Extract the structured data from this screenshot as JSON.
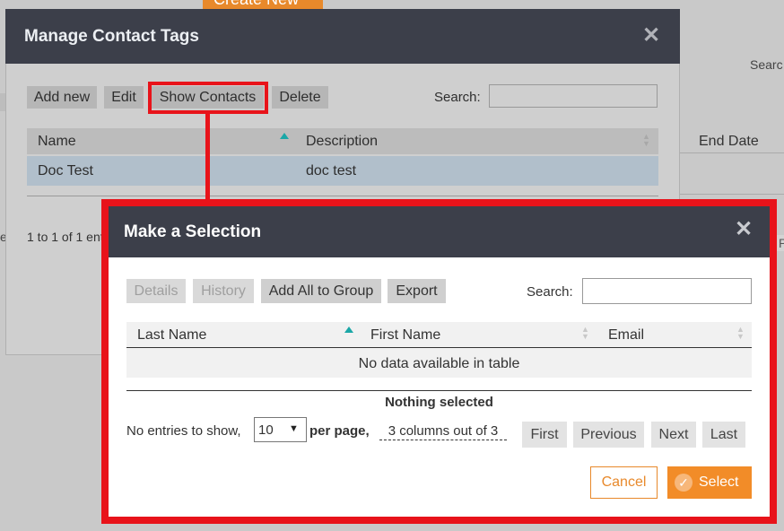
{
  "background": {
    "create_button_label": "Create New",
    "search_label": "Searc",
    "end_date_header": "End Date",
    "entries_fragment": "e",
    "right_fragment": "P"
  },
  "dialog_tags": {
    "title": "Manage Contact Tags",
    "close_icon": "close-icon",
    "toolbar": {
      "add_new": "Add new",
      "edit": "Edit",
      "show_contacts": "Show Contacts",
      "delete": "Delete"
    },
    "search_label": "Search:",
    "search_value": "",
    "columns": [
      "Name",
      "Description"
    ],
    "rows": [
      {
        "name": "Doc Test",
        "description": "doc test"
      }
    ],
    "info": "1 to 1 of 1 ent"
  },
  "dialog_selection": {
    "title": "Make a Selection",
    "close_icon": "close-icon",
    "toolbar": {
      "details": "Details",
      "history": "History",
      "add_all_to_group": "Add All to Group",
      "export": "Export"
    },
    "search_label": "Search:",
    "search_value": "",
    "columns": [
      "Last Name",
      "First Name",
      "Email"
    ],
    "empty_message": "No data available in table",
    "selection_status": "Nothing selected",
    "entries_label": "No entries to show,",
    "page_size": "10",
    "per_page_label": "per page,",
    "columns_label": "3 columns out of 3",
    "pagination": {
      "first": "First",
      "previous": "Previous",
      "next": "Next",
      "last": "Last"
    },
    "cancel_label": "Cancel",
    "select_label": "Select"
  },
  "colors": {
    "header_dark": "#3c3f4a",
    "highlight_red": "#e8131a",
    "accent_orange": "#f28c28",
    "sort_teal": "#1aa7a7"
  }
}
